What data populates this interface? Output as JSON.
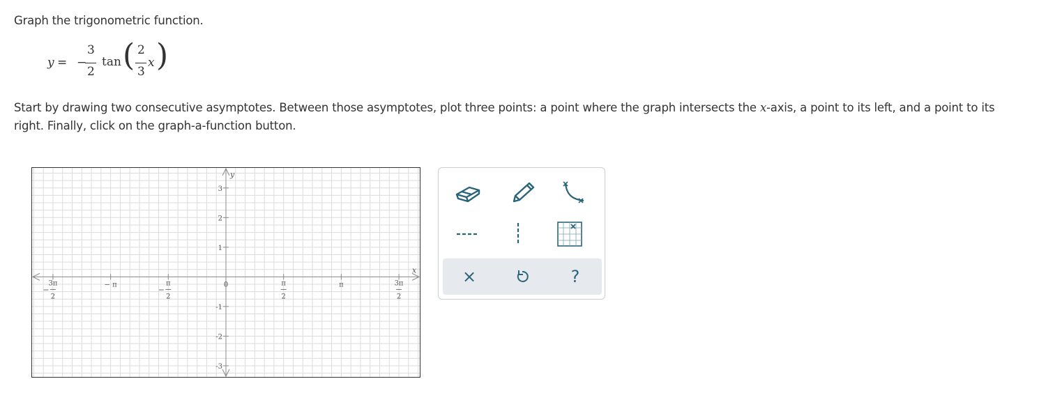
{
  "instruction": "Graph the trigonometric function.",
  "equation": {
    "lhs": "y",
    "equals": "=",
    "sign": "−",
    "coef_num": "3",
    "coef_den": "2",
    "func": "tan",
    "arg_num": "2",
    "arg_den": "3",
    "arg_var": "x"
  },
  "description": {
    "part1": "Start by drawing two consecutive asymptotes. Between those asymptotes, plot three points: a point where the graph intersects the ",
    "var": "x",
    "part2": "-axis, a point to its left, and a point to its right. Finally, click on the graph-a-function button."
  },
  "graph": {
    "x_axis_label": "x",
    "y_axis_label": "y",
    "x_range": [
      -5.3,
      5.3
    ],
    "y_range": [
      -3.4,
      3.7
    ],
    "grid": true,
    "grid_step_x": 0.2618,
    "grid_step_y": 0.25,
    "colors": {
      "grid": "#dcdcdc",
      "axis": "#8a8a8a",
      "border": "#333333",
      "label": "#555555"
    },
    "x_ticks": [
      {
        "value": -4.712,
        "num": "3π",
        "den": "2",
        "sign": "−"
      },
      {
        "value": -3.1416,
        "text": "− π"
      },
      {
        "value": -1.5708,
        "num": "π",
        "den": "2",
        "sign": "−"
      },
      {
        "value": 0,
        "text": "0"
      },
      {
        "value": 1.5708,
        "num": "π",
        "den": "2"
      },
      {
        "value": 3.1416,
        "text": "π"
      },
      {
        "value": 4.712,
        "num": "3π",
        "den": "2"
      }
    ],
    "y_ticks": [
      {
        "value": 3,
        "text": "3"
      },
      {
        "value": 2,
        "text": "2"
      },
      {
        "value": 1,
        "text": "1"
      },
      {
        "value": -1,
        "text": "-1"
      },
      {
        "value": -2,
        "text": "-2"
      },
      {
        "value": -3,
        "text": "-3"
      }
    ]
  },
  "toolbox": {
    "accent_color": "#2a6478",
    "tools": [
      "eraser-icon",
      "pencil-icon",
      "graph-function-icon",
      "horizontal-asymptote-icon",
      "vertical-asymptote-icon",
      "point-grid-icon"
    ],
    "actions": {
      "clear": "×",
      "undo": "undo-icon",
      "help": "?"
    }
  }
}
